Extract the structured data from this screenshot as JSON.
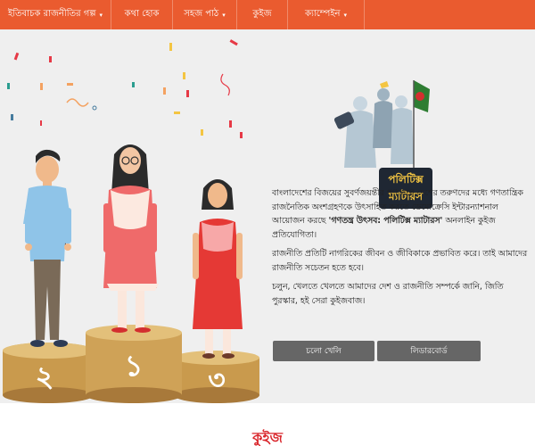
{
  "nav": {
    "items": [
      {
        "label": "ইতিবাচক রাজনীতির গল্প",
        "dropdown": true
      },
      {
        "label": "কথা হোক",
        "dropdown": false
      },
      {
        "label": "সহজ পাঠ",
        "dropdown": true
      },
      {
        "label": "কুইজ",
        "dropdown": false
      },
      {
        "label": "ক্যাম্পেইন",
        "dropdown": true
      }
    ],
    "caret": "▾",
    "color": "#ea5b2f"
  },
  "illustration": {
    "podium": {
      "first": "১",
      "second": "২",
      "third": "৩"
    }
  },
  "logo": {
    "line1": "পলিটিক্স",
    "line2": "ম্যাটারস"
  },
  "intro": {
    "p1_prefix": "বাংলাদেশের বিজয়ের সুবর্ণজয়ন্তীর পুণ্যলগ্নে দেশের তরুণদের মধ্যে গণতান্ত্রিক রাজনৈতিক অংশগ্রহণকে উৎসাহিত করতে ডেমোক্রেসি ইন্টারন্যাশনাল আয়োজন করছে",
    "p1_bold": "'গণতন্ত্র উৎসব: পলিটিক্স ম্যাটারস'",
    "p1_suffix": "অনলাইন কুইজ প্রতিযোগিতা।",
    "p2": "রাজনীতি প্রতিটি নাগরিকের জীবন ও জীবিকাকে প্রভাবিত করে। তাই আমাদের রাজনীতি সচেতন হতে হবে।",
    "p3": "চলুন, খেলতে খেলতে আমাদের দেশ ও রাজনীতি সম্পর্কে জানি, জিতি পুরস্কার, হই সেরা কুইজবাজ।"
  },
  "buttons": {
    "play": "চলো খেলি",
    "leaderboard": "লিডারবোর্ড"
  },
  "section": {
    "title": "কুইজ"
  },
  "colors": {
    "accent": "#ea5b2f",
    "title": "#d9252b",
    "button": "#666666"
  }
}
